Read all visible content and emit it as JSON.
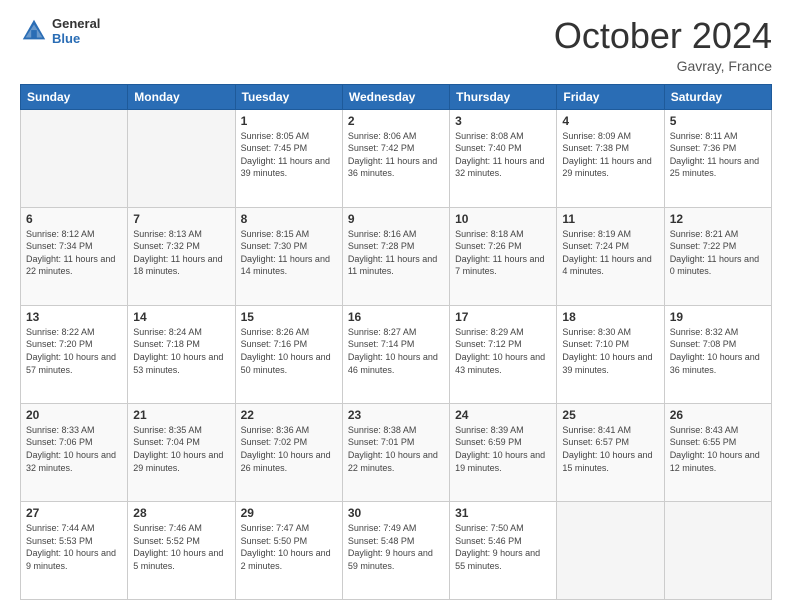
{
  "header": {
    "logo_general": "General",
    "logo_blue": "Blue",
    "month_title": "October 2024",
    "subtitle": "Gavray, France"
  },
  "days_of_week": [
    "Sunday",
    "Monday",
    "Tuesday",
    "Wednesday",
    "Thursday",
    "Friday",
    "Saturday"
  ],
  "weeks": [
    [
      {
        "day": "",
        "sunrise": "",
        "sunset": "",
        "daylight": ""
      },
      {
        "day": "",
        "sunrise": "",
        "sunset": "",
        "daylight": ""
      },
      {
        "day": "1",
        "sunrise": "Sunrise: 8:05 AM",
        "sunset": "Sunset: 7:45 PM",
        "daylight": "Daylight: 11 hours and 39 minutes."
      },
      {
        "day": "2",
        "sunrise": "Sunrise: 8:06 AM",
        "sunset": "Sunset: 7:42 PM",
        "daylight": "Daylight: 11 hours and 36 minutes."
      },
      {
        "day": "3",
        "sunrise": "Sunrise: 8:08 AM",
        "sunset": "Sunset: 7:40 PM",
        "daylight": "Daylight: 11 hours and 32 minutes."
      },
      {
        "day": "4",
        "sunrise": "Sunrise: 8:09 AM",
        "sunset": "Sunset: 7:38 PM",
        "daylight": "Daylight: 11 hours and 29 minutes."
      },
      {
        "day": "5",
        "sunrise": "Sunrise: 8:11 AM",
        "sunset": "Sunset: 7:36 PM",
        "daylight": "Daylight: 11 hours and 25 minutes."
      }
    ],
    [
      {
        "day": "6",
        "sunrise": "Sunrise: 8:12 AM",
        "sunset": "Sunset: 7:34 PM",
        "daylight": "Daylight: 11 hours and 22 minutes."
      },
      {
        "day": "7",
        "sunrise": "Sunrise: 8:13 AM",
        "sunset": "Sunset: 7:32 PM",
        "daylight": "Daylight: 11 hours and 18 minutes."
      },
      {
        "day": "8",
        "sunrise": "Sunrise: 8:15 AM",
        "sunset": "Sunset: 7:30 PM",
        "daylight": "Daylight: 11 hours and 14 minutes."
      },
      {
        "day": "9",
        "sunrise": "Sunrise: 8:16 AM",
        "sunset": "Sunset: 7:28 PM",
        "daylight": "Daylight: 11 hours and 11 minutes."
      },
      {
        "day": "10",
        "sunrise": "Sunrise: 8:18 AM",
        "sunset": "Sunset: 7:26 PM",
        "daylight": "Daylight: 11 hours and 7 minutes."
      },
      {
        "day": "11",
        "sunrise": "Sunrise: 8:19 AM",
        "sunset": "Sunset: 7:24 PM",
        "daylight": "Daylight: 11 hours and 4 minutes."
      },
      {
        "day": "12",
        "sunrise": "Sunrise: 8:21 AM",
        "sunset": "Sunset: 7:22 PM",
        "daylight": "Daylight: 11 hours and 0 minutes."
      }
    ],
    [
      {
        "day": "13",
        "sunrise": "Sunrise: 8:22 AM",
        "sunset": "Sunset: 7:20 PM",
        "daylight": "Daylight: 10 hours and 57 minutes."
      },
      {
        "day": "14",
        "sunrise": "Sunrise: 8:24 AM",
        "sunset": "Sunset: 7:18 PM",
        "daylight": "Daylight: 10 hours and 53 minutes."
      },
      {
        "day": "15",
        "sunrise": "Sunrise: 8:26 AM",
        "sunset": "Sunset: 7:16 PM",
        "daylight": "Daylight: 10 hours and 50 minutes."
      },
      {
        "day": "16",
        "sunrise": "Sunrise: 8:27 AM",
        "sunset": "Sunset: 7:14 PM",
        "daylight": "Daylight: 10 hours and 46 minutes."
      },
      {
        "day": "17",
        "sunrise": "Sunrise: 8:29 AM",
        "sunset": "Sunset: 7:12 PM",
        "daylight": "Daylight: 10 hours and 43 minutes."
      },
      {
        "day": "18",
        "sunrise": "Sunrise: 8:30 AM",
        "sunset": "Sunset: 7:10 PM",
        "daylight": "Daylight: 10 hours and 39 minutes."
      },
      {
        "day": "19",
        "sunrise": "Sunrise: 8:32 AM",
        "sunset": "Sunset: 7:08 PM",
        "daylight": "Daylight: 10 hours and 36 minutes."
      }
    ],
    [
      {
        "day": "20",
        "sunrise": "Sunrise: 8:33 AM",
        "sunset": "Sunset: 7:06 PM",
        "daylight": "Daylight: 10 hours and 32 minutes."
      },
      {
        "day": "21",
        "sunrise": "Sunrise: 8:35 AM",
        "sunset": "Sunset: 7:04 PM",
        "daylight": "Daylight: 10 hours and 29 minutes."
      },
      {
        "day": "22",
        "sunrise": "Sunrise: 8:36 AM",
        "sunset": "Sunset: 7:02 PM",
        "daylight": "Daylight: 10 hours and 26 minutes."
      },
      {
        "day": "23",
        "sunrise": "Sunrise: 8:38 AM",
        "sunset": "Sunset: 7:01 PM",
        "daylight": "Daylight: 10 hours and 22 minutes."
      },
      {
        "day": "24",
        "sunrise": "Sunrise: 8:39 AM",
        "sunset": "Sunset: 6:59 PM",
        "daylight": "Daylight: 10 hours and 19 minutes."
      },
      {
        "day": "25",
        "sunrise": "Sunrise: 8:41 AM",
        "sunset": "Sunset: 6:57 PM",
        "daylight": "Daylight: 10 hours and 15 minutes."
      },
      {
        "day": "26",
        "sunrise": "Sunrise: 8:43 AM",
        "sunset": "Sunset: 6:55 PM",
        "daylight": "Daylight: 10 hours and 12 minutes."
      }
    ],
    [
      {
        "day": "27",
        "sunrise": "Sunrise: 7:44 AM",
        "sunset": "Sunset: 5:53 PM",
        "daylight": "Daylight: 10 hours and 9 minutes."
      },
      {
        "day": "28",
        "sunrise": "Sunrise: 7:46 AM",
        "sunset": "Sunset: 5:52 PM",
        "daylight": "Daylight: 10 hours and 5 minutes."
      },
      {
        "day": "29",
        "sunrise": "Sunrise: 7:47 AM",
        "sunset": "Sunset: 5:50 PM",
        "daylight": "Daylight: 10 hours and 2 minutes."
      },
      {
        "day": "30",
        "sunrise": "Sunrise: 7:49 AM",
        "sunset": "Sunset: 5:48 PM",
        "daylight": "Daylight: 9 hours and 59 minutes."
      },
      {
        "day": "31",
        "sunrise": "Sunrise: 7:50 AM",
        "sunset": "Sunset: 5:46 PM",
        "daylight": "Daylight: 9 hours and 55 minutes."
      },
      {
        "day": "",
        "sunrise": "",
        "sunset": "",
        "daylight": ""
      },
      {
        "day": "",
        "sunrise": "",
        "sunset": "",
        "daylight": ""
      }
    ]
  ]
}
